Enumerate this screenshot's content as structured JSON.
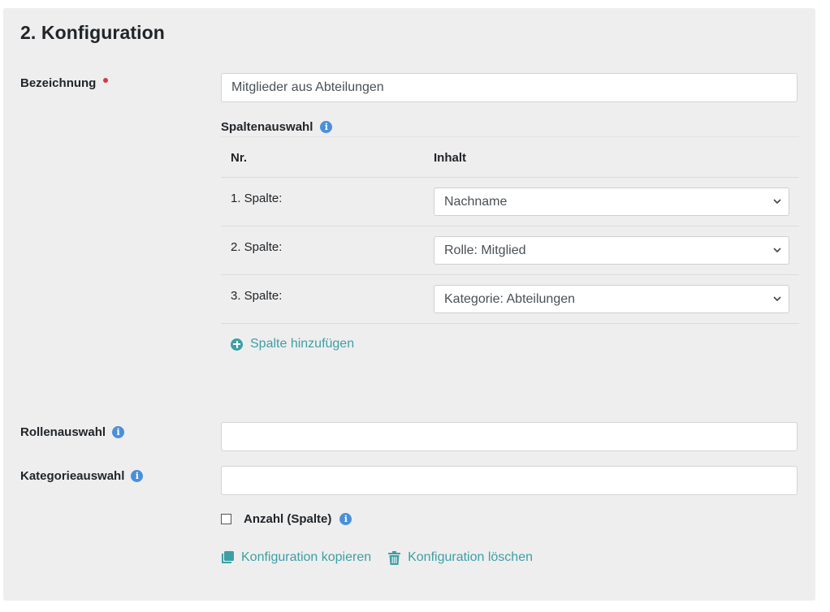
{
  "card": {
    "title": "2. Konfiguration"
  },
  "fields": {
    "bezeichnung": {
      "label": "Bezeichnung",
      "value": "Mitglieder aus Abteilungen",
      "required": true
    },
    "rollenauswahl": {
      "label": "Rollenauswahl",
      "value": ""
    },
    "kategorieauswahl": {
      "label": "Kategorieauswahl",
      "value": ""
    }
  },
  "columns": {
    "heading": "Spaltenauswahl",
    "header_nr": "Nr.",
    "header_inhalt": "Inhalt",
    "rows": [
      {
        "nr": "1. Spalte:",
        "inhalt": "Nachname"
      },
      {
        "nr": "2. Spalte:",
        "inhalt": "Rolle: Mitglied"
      },
      {
        "nr": "3. Spalte:",
        "inhalt": "Kategorie: Abteilungen"
      }
    ],
    "add_label": "Spalte hinzufügen"
  },
  "count_option": {
    "label": "Anzahl (Spalte)",
    "checked": false
  },
  "actions": {
    "copy_label": "Konfiguration kopieren",
    "delete_label": "Konfiguration löschen"
  },
  "icons": {
    "info": "info-icon",
    "required": "required-dot",
    "add": "plus-circle-icon",
    "copy": "copy-icon",
    "delete": "trash-icon",
    "dropdown": "chevron-down-icon"
  },
  "colors": {
    "card_background": "#eeeeee",
    "accent": "#3d9fa6",
    "info": "#4a90d9",
    "required": "#dc3545"
  }
}
